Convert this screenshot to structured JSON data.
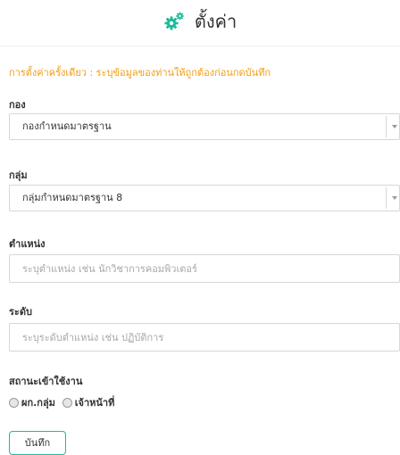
{
  "header": {
    "title": "ตั้งค่า",
    "icon": "gears-icon",
    "icon_color": "#1abc9c"
  },
  "notice": "การตั้งค่าครั้งเดียว : ระบุข้อมูลของท่านให้ถูกต้องก่อนกดบันทึก",
  "notice_color": "#f39c12",
  "division": {
    "label": "กอง",
    "value": "กองกำหนดมาตรฐาน"
  },
  "group": {
    "label": "กลุ่ม",
    "value": "กลุ่มกำหนดมาตรฐาน 8"
  },
  "position": {
    "label": "ตำแหน่ง",
    "value": "",
    "placeholder": "ระบุตำแหน่ง เช่น นักวิชาการคอมพิวเตอร์"
  },
  "level": {
    "label": "ระดับ",
    "value": "",
    "placeholder": "ระบุระดับตำแหน่ง เช่น ปฏิบัติการ"
  },
  "status": {
    "label": "สถานะเข้าใช้งาน",
    "options": [
      "ผก.กลุ่ม",
      "เจ้าหน้าที่"
    ]
  },
  "save_button": {
    "label": "บันทึก",
    "border_color": "#1abc9c"
  }
}
